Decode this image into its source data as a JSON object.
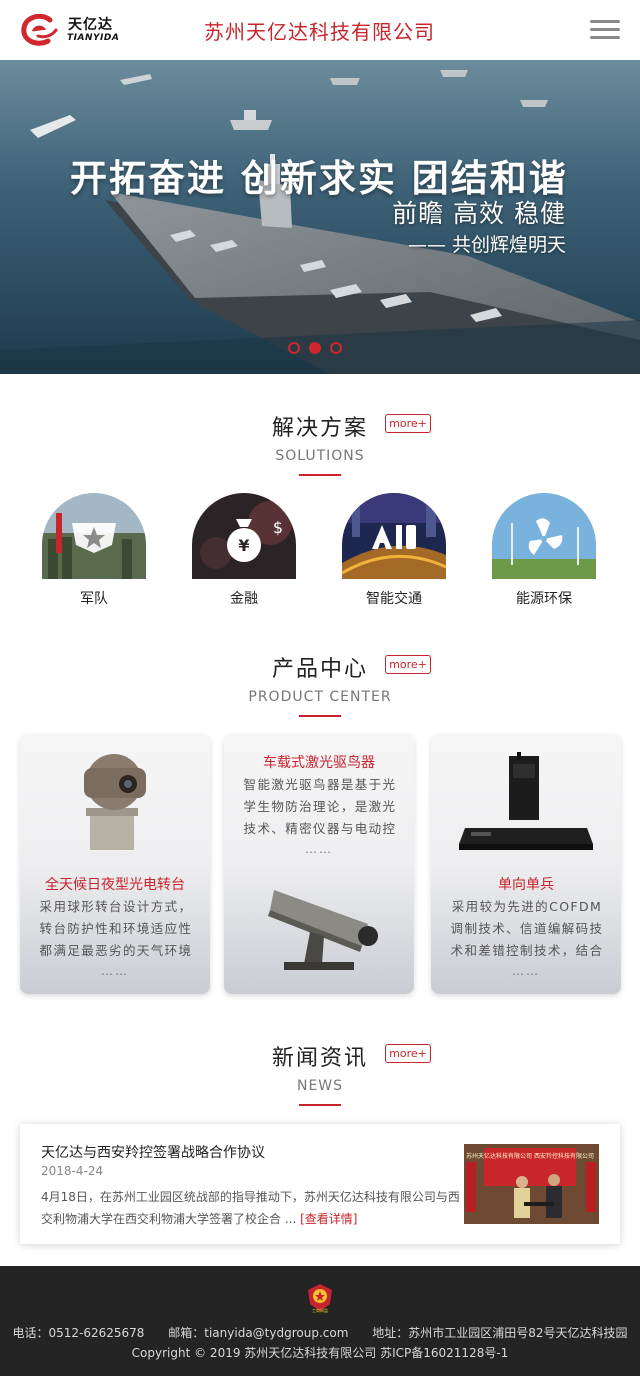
{
  "header": {
    "logo_cn": "天亿达",
    "logo_en": "TIANYIDA",
    "company_name": "苏州天亿达科技有限公司",
    "menu_icon": "hamburger-menu-icon"
  },
  "banner": {
    "slogan": "开拓奋进 创新求实 团结和谐",
    "sub1": "前瞻 高效 稳健",
    "sub2": "—— 共创辉煌明天",
    "slides": 3,
    "active_slide": 2
  },
  "solutions": {
    "title": "解决方案",
    "subtitle": "SOLUTIONS",
    "more": "more+",
    "items": [
      {
        "label": "军队",
        "icon": "army-star-icon"
      },
      {
        "label": "金融",
        "icon": "money-bag-icon"
      },
      {
        "label": "智能交通",
        "icon": "ai-traffic-icon"
      },
      {
        "label": "能源环保",
        "icon": "fan-icon"
      }
    ]
  },
  "products": {
    "title": "产品中心",
    "subtitle": "PRODUCT CENTER",
    "more": "more+",
    "items": [
      {
        "name": "全天候日夜型光电转台",
        "desc": "采用球形转台设计方式，转台防护性和环境适应性都满足最恶劣的天气环境",
        "ellipsis": "……"
      },
      {
        "name": "车载式激光驱鸟器",
        "desc": "智能激光驱鸟器是基于光学生物防治理论，是激光技术、精密仪器与电动控",
        "ellipsis": "……"
      },
      {
        "name": "单向单兵",
        "desc": "采用较为先进的COFDM调制技术、信道编解码技术和差错控制技术，结合",
        "ellipsis": "……"
      }
    ]
  },
  "news": {
    "title": "新闻资讯",
    "subtitle": "NEWS",
    "more": "more+",
    "item": {
      "title": "天亿达与西安羚控签署战略合作协议",
      "date": "2018-4-24",
      "body": "4月18日，在苏州工业园区统战部的指导推动下，苏州天亿达科技有限公司与西交利物浦大学在西交利物浦大学签署了校企合 ...",
      "detail": "[查看详情]",
      "image_banner": "苏州天亿达科技有限公司 西安羚控科技有限公司"
    }
  },
  "footer": {
    "badge_text": "工商网监",
    "phone": "电话：0512-62625678",
    "email": "邮箱：tianyida@tydgroup.com",
    "address": "地址：苏州市工业园区浦田号82号天亿达科技园",
    "copyright": "Copyright © 2019 苏州天亿达科技有限公司 苏ICP备16021128号-1"
  },
  "colors": {
    "brand_red": "#c8242c",
    "footer_bg": "#242424"
  }
}
